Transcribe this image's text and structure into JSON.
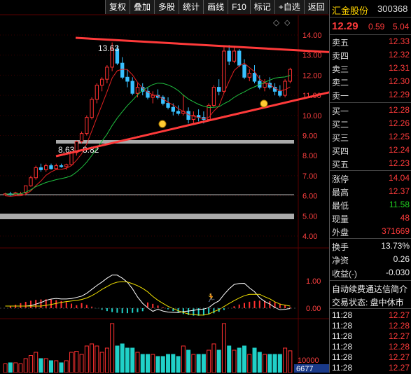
{
  "toolbar": [
    "复权",
    "叠加",
    "多股",
    "统计",
    "画线",
    "F10",
    "标记",
    "+自选",
    "返回"
  ],
  "stock": {
    "name": "汇金股份",
    "code": "300368",
    "price": "12.29",
    "change": "0.59",
    "pct": "5.04"
  },
  "asks": [
    {
      "label": "卖五",
      "price": "12.33"
    },
    {
      "label": "卖四",
      "price": "12.32"
    },
    {
      "label": "卖三",
      "price": "12.31"
    },
    {
      "label": "卖二",
      "price": "12.30"
    },
    {
      "label": "卖一",
      "price": "12.29"
    }
  ],
  "bids": [
    {
      "label": "买一",
      "price": "12.28"
    },
    {
      "label": "买二",
      "price": "12.26"
    },
    {
      "label": "买三",
      "price": "12.25"
    },
    {
      "label": "买四",
      "price": "12.24"
    },
    {
      "label": "买五",
      "price": "12.23"
    }
  ],
  "stats": [
    {
      "label": "涨停",
      "value": "14.04",
      "color": "red"
    },
    {
      "label": "最高",
      "value": "12.37",
      "color": "red"
    },
    {
      "label": "最低",
      "value": "11.58",
      "color": "green"
    },
    {
      "label": "现量",
      "value": "48",
      "color": "red"
    },
    {
      "label": "外盘",
      "value": "371669",
      "color": "red"
    }
  ],
  "stats2": [
    {
      "label": "换手",
      "value": "13.73%",
      "color": "white"
    },
    {
      "label": "净资",
      "value": "0.26",
      "color": "white"
    },
    {
      "label": "收益(-)",
      "value": "-0.030",
      "color": "white"
    }
  ],
  "notice": "自动续费通达信简介",
  "status": "交易状态: 盘中休市",
  "ticks": [
    {
      "time": "11:28",
      "price": "12.27"
    },
    {
      "time": "11:28",
      "price": "12.28"
    },
    {
      "time": "11:28",
      "price": "12.27"
    },
    {
      "time": "11:28",
      "price": "12.28"
    },
    {
      "time": "11:28",
      "price": "12.27"
    },
    {
      "time": "11:28",
      "price": "12.27"
    }
  ],
  "chart_data": {
    "type": "candlestick",
    "price_ticks": [
      "14.00",
      "13.00",
      "12.00",
      "11.00",
      "10.00",
      "9.00",
      "8.00",
      "7.00",
      "6.00",
      "5.00",
      "4.00"
    ],
    "macd_ticks": [
      "1.00",
      "0.00"
    ],
    "vol_ticks": [
      "10000"
    ],
    "annotations": {
      "high": "13.63",
      "low1": "8.63",
      "low2": "8.82"
    },
    "volume_label": "6677",
    "ohlc": [
      [
        6.05,
        6.15,
        6.0,
        6.1
      ],
      [
        6.1,
        6.2,
        6.0,
        6.05
      ],
      [
        6.05,
        6.2,
        6.0,
        6.15
      ],
      [
        6.1,
        6.2,
        6.05,
        6.1
      ],
      [
        6.15,
        6.5,
        6.1,
        6.5
      ],
      [
        6.5,
        7.0,
        6.45,
        6.9
      ],
      [
        6.9,
        7.5,
        6.8,
        7.4
      ],
      [
        7.4,
        7.6,
        7.2,
        7.3
      ],
      [
        7.3,
        7.6,
        7.2,
        7.5
      ],
      [
        7.5,
        7.6,
        7.3,
        7.35
      ],
      [
        7.35,
        7.6,
        7.3,
        7.5
      ],
      [
        7.5,
        7.6,
        7.4,
        7.45
      ],
      [
        7.45,
        7.6,
        7.3,
        7.55
      ],
      [
        7.55,
        8.2,
        7.5,
        8.15
      ],
      [
        8.15,
        8.75,
        8.0,
        8.7
      ],
      [
        8.7,
        9.2,
        8.6,
        9.1
      ],
      [
        9.1,
        10.0,
        9.0,
        9.9
      ],
      [
        9.9,
        10.9,
        9.8,
        10.8
      ],
      [
        10.8,
        11.6,
        10.6,
        11.5
      ],
      [
        11.5,
        11.9,
        11.2,
        11.8
      ],
      [
        11.8,
        12.5,
        11.6,
        12.4
      ],
      [
        12.4,
        13.63,
        12.2,
        13.3
      ],
      [
        13.3,
        13.5,
        12.5,
        12.6
      ],
      [
        12.6,
        12.9,
        11.8,
        11.9
      ],
      [
        11.9,
        12.3,
        11.4,
        11.7
      ],
      [
        11.7,
        11.9,
        11.0,
        11.1
      ],
      [
        11.1,
        11.6,
        10.9,
        11.4
      ],
      [
        11.4,
        11.6,
        11.0,
        11.2
      ],
      [
        11.2,
        11.4,
        10.8,
        10.9
      ],
      [
        10.9,
        11.2,
        10.6,
        11.0
      ],
      [
        11.0,
        11.3,
        10.8,
        10.9
      ],
      [
        10.9,
        11.0,
        10.5,
        10.6
      ],
      [
        10.6,
        10.9,
        10.3,
        10.4
      ],
      [
        10.4,
        10.6,
        10.0,
        10.2
      ],
      [
        10.2,
        10.5,
        10.0,
        10.1
      ],
      [
        10.1,
        11.0,
        10.0,
        10.2
      ],
      [
        10.2,
        10.4,
        9.6,
        9.8
      ],
      [
        9.8,
        10.2,
        9.6,
        10.0
      ],
      [
        10.0,
        10.3,
        9.7,
        9.9
      ],
      [
        9.9,
        10.2,
        9.6,
        9.8
      ],
      [
        9.8,
        10.6,
        9.8,
        10.5
      ],
      [
        10.5,
        11.5,
        10.4,
        11.4
      ],
      [
        11.4,
        11.8,
        11.0,
        11.2
      ],
      [
        11.2,
        13.4,
        11.1,
        13.2
      ],
      [
        13.2,
        13.5,
        12.5,
        12.7
      ],
      [
        12.7,
        13.4,
        12.6,
        13.2
      ],
      [
        13.2,
        13.3,
        12.4,
        12.5
      ],
      [
        12.5,
        12.8,
        11.8,
        11.9
      ],
      [
        11.9,
        12.3,
        11.7,
        12.1
      ],
      [
        12.1,
        12.5,
        11.6,
        11.7
      ],
      [
        11.7,
        12.0,
        11.3,
        11.4
      ],
      [
        11.4,
        11.8,
        11.2,
        11.6
      ],
      [
        11.6,
        11.9,
        11.3,
        11.4
      ],
      [
        11.4,
        11.6,
        11.0,
        11.2
      ],
      [
        11.2,
        11.5,
        10.9,
        11.0
      ],
      [
        11.0,
        11.8,
        10.9,
        11.7
      ],
      [
        11.7,
        12.37,
        11.6,
        12.29
      ]
    ]
  }
}
